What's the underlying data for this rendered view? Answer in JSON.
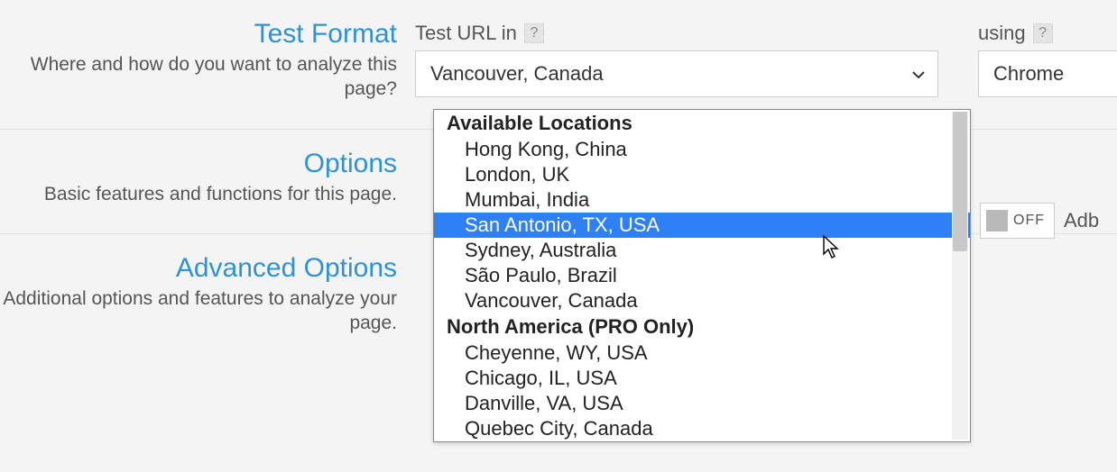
{
  "sections": {
    "format": {
      "title": "Test Format",
      "desc": "Where and how do you want to analyze this page?"
    },
    "options": {
      "title": "Options",
      "desc": "Basic features and functions for this page."
    },
    "advanced": {
      "title": "Advanced Options",
      "desc": "Additional options and features to analyze your page."
    }
  },
  "location": {
    "label": "Test URL in",
    "selected": "Vancouver, Canada",
    "groups": [
      {
        "label": "Available Locations",
        "items": [
          "Hong Kong, China",
          "London, UK",
          "Mumbai, India",
          "San Antonio, TX, USA",
          "Sydney, Australia",
          "São Paulo, Brazil",
          "Vancouver, Canada"
        ]
      },
      {
        "label": "North America (PRO Only)",
        "items": [
          "Cheyenne, WY, USA",
          "Chicago, IL, USA",
          "Danville, VA, USA",
          "Quebec City, Canada"
        ]
      }
    ],
    "highlighted": "San Antonio, TX, USA"
  },
  "browser": {
    "label": "using",
    "selected": "Chrome"
  },
  "adblock": {
    "label": "Adb",
    "state": "OFF"
  },
  "help_glyph": "?"
}
